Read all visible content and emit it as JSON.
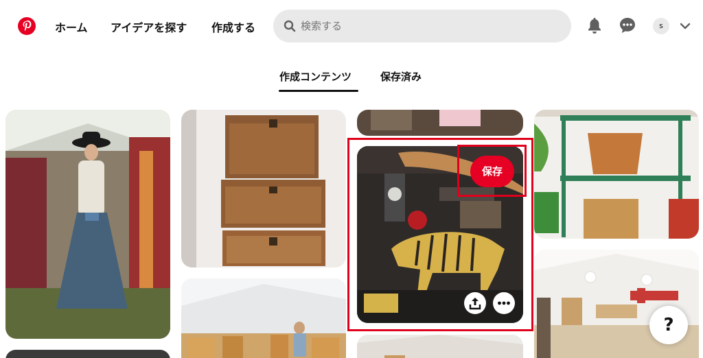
{
  "nav": {
    "home": "ホーム",
    "ideas": "アイデアを探す",
    "create": "作成する"
  },
  "search": {
    "placeholder": "検索する"
  },
  "user": {
    "initial": "s"
  },
  "tabs": {
    "created": "作成コンテンツ",
    "saved": "保存済み"
  },
  "pin": {
    "save_label": "保存"
  },
  "help": {
    "label": "?"
  },
  "colors": {
    "brand": "#e60023",
    "highlight": "#e0001b"
  },
  "icons": [
    "pinterest-logo-icon",
    "search-icon",
    "bell-icon",
    "chat-icon",
    "chevron-down-icon",
    "share-icon",
    "more-icon"
  ]
}
